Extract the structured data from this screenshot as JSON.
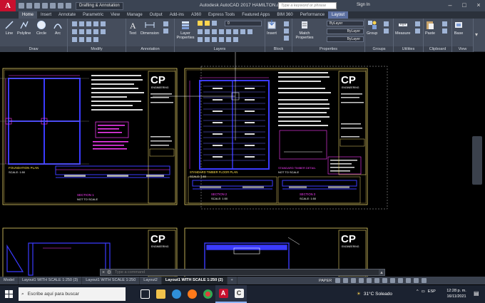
{
  "titlebar": {
    "app_letter": "A",
    "workspace": "Drafting & Annotation",
    "title": "Autodesk AutoCAD 2017    HAMILTON.dwg",
    "search_placeholder": "Type a keyword or phrase",
    "signin": "Sign In"
  },
  "tabs": [
    "Home",
    "Insert",
    "Annotate",
    "Parametric",
    "View",
    "Manage",
    "Output",
    "Add-ins",
    "A360",
    "Express Tools",
    "Featured Apps",
    "BIM 360",
    "Performance",
    "Layout"
  ],
  "ribbon": {
    "draw": {
      "title": "Draw",
      "line": "Line",
      "polyline": "Polyline",
      "circle": "Circle",
      "arc": "Arc"
    },
    "modify": {
      "title": "Modify"
    },
    "annotation": {
      "title": "Annotation",
      "text": "Text",
      "dimension": "Dimension"
    },
    "layers": {
      "title": "Layers",
      "layer_properties": "Layer Properties",
      "layer_value": "0"
    },
    "block": {
      "title": "Block",
      "insert": "Insert"
    },
    "properties": {
      "title": "Properties",
      "match": "Match Properties",
      "bylayer1": "ByLayer",
      "bylayer2": "ByLayer",
      "bylayer3": "ByLayer"
    },
    "groups": {
      "title": "Groups",
      "group": "Group"
    },
    "utilities": {
      "title": "Utilities",
      "measure": "Measure"
    },
    "clipboard": {
      "title": "Clipboard",
      "paste": "Paste"
    },
    "view": {
      "title": "View",
      "base": "Base"
    }
  },
  "drawing": {
    "sheet1": {
      "logo": "CP",
      "logo_sub": "ENGINEERING",
      "plan_title": "FOUNDATION PLAN",
      "plan_scale": "SCALE: 1:50",
      "section_title": "SECTION 1",
      "section_scale": "NOT TO SCALE"
    },
    "sheet2": {
      "logo": "CP",
      "logo_sub": "ENGINEERING",
      "plan_title": "STANDARD TIMBER FLOOR PLAN",
      "plan_scale": "SCALE: 1:50",
      "detail_title": "STANDARD TIMBER DETAIL",
      "detail_scale": "NOT TO SCALE",
      "section_a": "SECTION 2",
      "section_a_scale": "SCALE: 1:50",
      "section_b": "SECTION 3",
      "section_b_scale": "SCALE: 1:50"
    },
    "sheet3": {
      "logo": "CP",
      "logo_sub": "ENGINEERING"
    },
    "sheet4": {
      "logo": "CP",
      "logo_sub": "ENGINEERING"
    }
  },
  "command": {
    "placeholder": "Type a command"
  },
  "layout_tabs": [
    "Model",
    "Layout1 WITH SCALE 1:250 (3)",
    "Layout1 WITH SCALE 1:250",
    "Layout2",
    "Layout1 WITH SCALE 1:250 (2)"
  ],
  "status": {
    "paper": "PAPER"
  },
  "taskbar": {
    "search_placeholder": "Escribe aquí para buscar",
    "weather": "31°C  Soleado",
    "lang": "ESP",
    "time": "12:28 p. m.",
    "date": "16/11/2021"
  },
  "colors": {
    "autocad_red": "#c8102e",
    "ribbon_bg": "#454d5c",
    "drawing_bg": "#000000",
    "frame_yellow": "#e8d26a",
    "blue_line": "#3b3bff",
    "magenta_line": "#ff3dff",
    "active_layout_tab": "#1f242b"
  }
}
